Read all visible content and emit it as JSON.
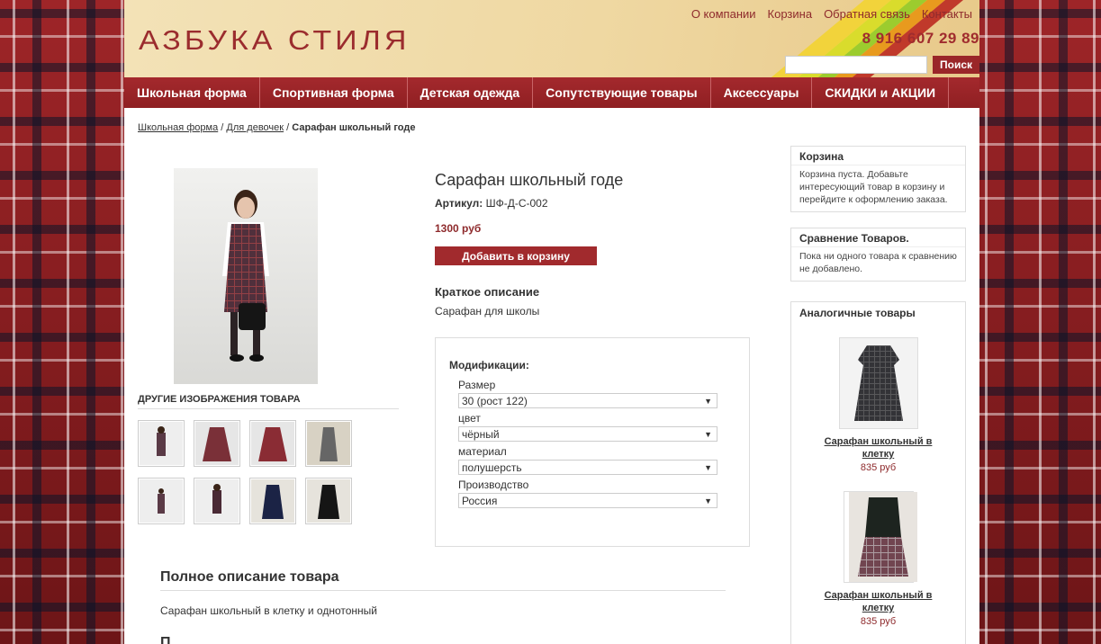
{
  "header": {
    "logo": "АЗБУКА СТИЛЯ",
    "top_links": [
      "О компании",
      "Корзина",
      "Обратная связь",
      "Контакты"
    ],
    "phone": "8 916 607 29 89",
    "search_placeholder": "",
    "search_button": "Поиск"
  },
  "nav": [
    "Школьная форма",
    "Спортивная форма",
    "Детская одежда",
    "Сопутствующие товары",
    "Аксессуары",
    "СКИДКИ и АКЦИИ"
  ],
  "breadcrumb": {
    "items": [
      "Школьная форма",
      "Для девочек"
    ],
    "separator": "/",
    "current": "Сарафан школьный годе"
  },
  "product": {
    "title": "Сарафан школьный годе",
    "sku_label": "Артикул:",
    "sku": "ШФ-Д-С-002",
    "price": "1300 руб",
    "add_to_cart": "Добавить в корзину",
    "short_heading": "Краткое описание",
    "short_text": "Сарафан для школы",
    "other_images_title": "ДРУГИЕ ИЗОБРАЖЕНИЯ ТОВАРА",
    "modifications": {
      "heading": "Модификации:",
      "options": [
        {
          "label": "Размер",
          "value": "30 (рост 122)"
        },
        {
          "label": "цвет",
          "value": "чёрный"
        },
        {
          "label": "материал",
          "value": "полушерсть"
        },
        {
          "label": "Производство",
          "value": "Россия"
        }
      ]
    },
    "full_heading": "Полное описание товара",
    "full_text": "Сарафан школьный в клетку и однотонный",
    "full_heading2": "П"
  },
  "sidebar": {
    "cart": {
      "title": "Корзина",
      "text": "Корзина пуста. Добавьте интересующий товар в корзину и перейдите к оформлению заказа."
    },
    "compare": {
      "title": "Сравнение Товаров.",
      "text": "Пока ни одного товара к сравнению не добавлено."
    },
    "similar": {
      "title": "Аналогичные товары",
      "items": [
        {
          "name": "Сарафан школьный в клетку",
          "price": "835 руб"
        },
        {
          "name": "Сарафан школьный в клетку",
          "price": "835 руб"
        }
      ]
    }
  },
  "colors": {
    "accent": "#9a2629",
    "price": "#8e2a2c"
  }
}
